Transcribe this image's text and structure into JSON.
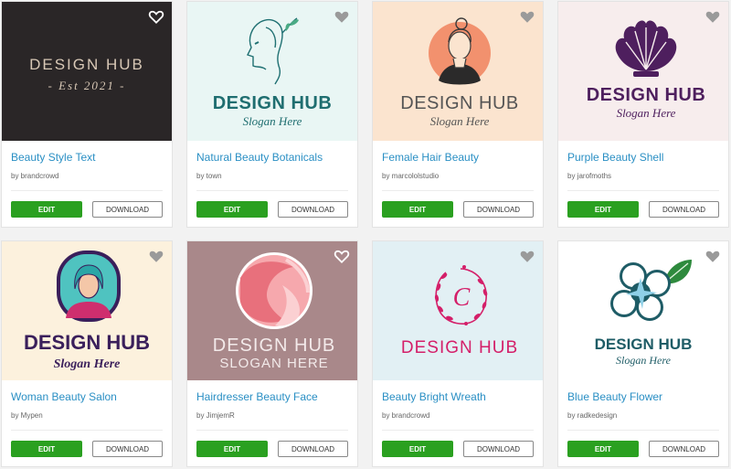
{
  "buttons": {
    "edit_label": "EDIT",
    "download_label": "DOWNLOAD"
  },
  "cards": [
    {
      "title": "Beauty Style Text",
      "byline": "by brandcrowd",
      "logo_lines": [
        "DESIGN HUB",
        "- Est 2021 -"
      ],
      "heart": "heart-outline-white"
    },
    {
      "title": "Natural Beauty Botanicals",
      "byline": "by town",
      "logo_lines": [
        "DESIGN HUB",
        "Slogan Here"
      ],
      "heart": "heart-grey"
    },
    {
      "title": "Female Hair Beauty",
      "byline": "by marcololstudio",
      "logo_lines": [
        "DESIGN HUB",
        "Slogan Here"
      ],
      "heart": "heart-grey"
    },
    {
      "title": "Purple Beauty Shell",
      "byline": "by jarofmoths",
      "logo_lines": [
        "DESIGN HUB",
        "Slogan Here"
      ],
      "heart": "heart-grey"
    },
    {
      "title": "Woman Beauty Salon",
      "byline": "by Mypen",
      "logo_lines": [
        "DESIGN HUB",
        "Slogan Here"
      ],
      "heart": "heart-grey"
    },
    {
      "title": "Hairdresser Beauty Face",
      "byline": "by JimjemR",
      "logo_lines": [
        "DESIGN HUB",
        "SLOGAN HERE"
      ],
      "heart": "heart-outline-white"
    },
    {
      "title": "Beauty Bright Wreath",
      "byline": "by brandcrowd",
      "logo_lines": [
        "C",
        "DESIGN HUB"
      ],
      "heart": "heart-grey"
    },
    {
      "title": "Blue Beauty Flower",
      "byline": "by radkedesign",
      "logo_lines": [
        "DESIGN HUB",
        "Slogan Here"
      ],
      "heart": "heart-grey"
    }
  ],
  "colors": {
    "link": "#2a8fc4",
    "edit_button": "#2aa020"
  }
}
